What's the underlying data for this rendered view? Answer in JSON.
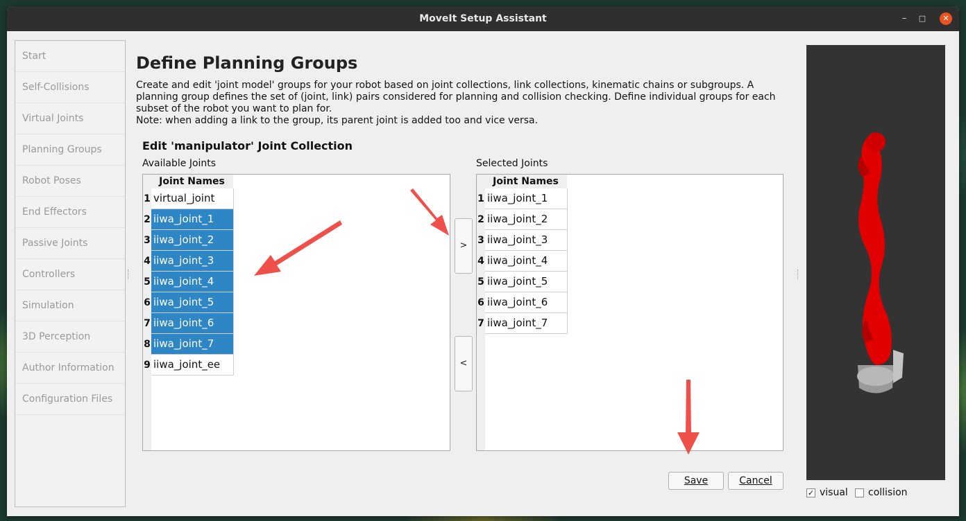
{
  "window": {
    "title": "MoveIt Setup Assistant"
  },
  "window_controls": {
    "minimize": "–",
    "maximize": "□",
    "close": "✕"
  },
  "sidebar": {
    "items": [
      {
        "label": "Start"
      },
      {
        "label": "Self-Collisions"
      },
      {
        "label": "Virtual Joints"
      },
      {
        "label": "Planning Groups"
      },
      {
        "label": "Robot Poses"
      },
      {
        "label": "End Effectors"
      },
      {
        "label": "Passive Joints"
      },
      {
        "label": "Controllers"
      },
      {
        "label": "Simulation"
      },
      {
        "label": "3D Perception"
      },
      {
        "label": "Author Information"
      },
      {
        "label": "Configuration Files"
      }
    ]
  },
  "main": {
    "title": "Define Planning Groups",
    "description": "Create and edit 'joint model' groups for your robot based on joint collections, link collections, kinematic chains or subgroups. A planning group defines the set of (joint, link) pairs considered for planning and collision checking. Define individual groups for each subset of the robot you want to plan for.",
    "note": "Note: when adding a link to the group, its parent joint is added too and vice versa.",
    "edit_title": "Edit 'manipulator' Joint Collection",
    "available": {
      "label": "Available Joints",
      "header": "Joint Names",
      "rows": [
        {
          "num": "1",
          "name": "virtual_joint",
          "selected": false
        },
        {
          "num": "2",
          "name": "iiwa_joint_1",
          "selected": true
        },
        {
          "num": "3",
          "name": "iiwa_joint_2",
          "selected": true
        },
        {
          "num": "4",
          "name": "iiwa_joint_3",
          "selected": true
        },
        {
          "num": "5",
          "name": "iiwa_joint_4",
          "selected": true
        },
        {
          "num": "6",
          "name": "iiwa_joint_5",
          "selected": true
        },
        {
          "num": "7",
          "name": "iiwa_joint_6",
          "selected": true
        },
        {
          "num": "8",
          "name": "iiwa_joint_7",
          "selected": true
        },
        {
          "num": "9",
          "name": "iiwa_joint_ee",
          "selected": false
        }
      ]
    },
    "selected": {
      "label": "Selected Joints",
      "header": "Joint Names",
      "rows": [
        {
          "num": "1",
          "name": "iiwa_joint_1"
        },
        {
          "num": "2",
          "name": "iiwa_joint_2"
        },
        {
          "num": "3",
          "name": "iiwa_joint_3"
        },
        {
          "num": "4",
          "name": "iiwa_joint_4"
        },
        {
          "num": "5",
          "name": "iiwa_joint_5"
        },
        {
          "num": "6",
          "name": "iiwa_joint_6"
        },
        {
          "num": "7",
          "name": "iiwa_joint_7"
        }
      ]
    },
    "add_button": ">",
    "remove_button": "<",
    "save_button": "Save",
    "cancel_button": "Cancel"
  },
  "viewer": {
    "visual_label": "visual",
    "visual_checked": true,
    "collision_label": "collision",
    "collision_checked": false
  },
  "colors": {
    "selection": "#2f86c4",
    "robot": "#e00000",
    "annotation_arrow": "#f0504a",
    "viewer_bg": "#333333"
  }
}
